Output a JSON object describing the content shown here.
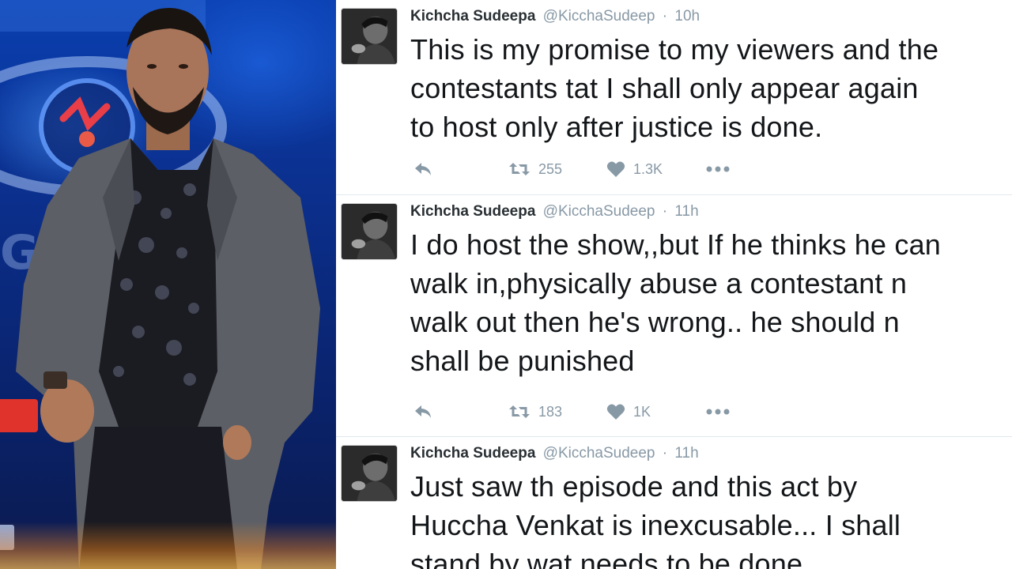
{
  "tweets": [
    {
      "name": "Kichcha Sudeepa",
      "handle": "@KicchaSudeep",
      "separator": "·",
      "time": "10h",
      "lines": [
        "This is my promise to my viewers and the",
        "contestants tat I shall only appear again",
        "to host only after justice is done."
      ],
      "retweets": "255",
      "likes": "1.3K"
    },
    {
      "name": "Kichcha Sudeepa",
      "handle": "@KicchaSudeep",
      "separator": "·",
      "time": "11h",
      "lines": [
        "I do host the show,,but If he thinks he can",
        "walk in,physically abuse a contestant n",
        "walk out then he's wrong.. he should n",
        "shall be punished"
      ],
      "retweets": "183",
      "likes": "1K"
    },
    {
      "name": "Kichcha Sudeepa",
      "handle": "@KicchaSudeep",
      "separator": "·",
      "time": "11h",
      "lines": [
        "Just saw th episode and this act by",
        "Huccha Venkat is inexcusable... I shall",
        "stand by wat needs to be done."
      ]
    }
  ],
  "icons": {
    "reply": "reply-icon",
    "retweet": "retweet-icon",
    "like": "heart-icon",
    "more": "more-icon"
  },
  "colors": {
    "name": "#292f33",
    "meta": "#8899a6",
    "text": "#14171a",
    "icon": "#8899a6",
    "divider": "#e1e8ed"
  }
}
